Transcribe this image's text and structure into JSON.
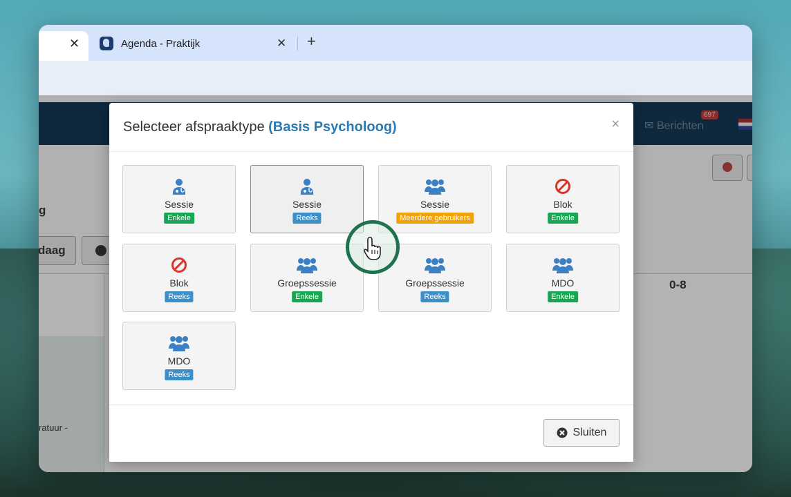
{
  "browser": {
    "tabs": [
      {
        "title": "Agenda - Praktijk"
      }
    ],
    "close_glyph": "✕",
    "new_tab_glyph": "+"
  },
  "background_page": {
    "berichten_label": "Berichten",
    "berichten_count": "697",
    "text_g": "g",
    "text_daag": "daag",
    "text_08": "0-8",
    "text_ratuur": "ratuur -"
  },
  "modal": {
    "title": "Selecteer afspraaktype",
    "title_highlight": "(Basis Psycholoog)",
    "close_glyph": "×",
    "tiles": [
      {
        "icon": "user-doctor-icon",
        "label": "Sessie",
        "badge": "Enkele",
        "badge_color": "#17a653"
      },
      {
        "icon": "user-doctor-icon",
        "label": "Sessie",
        "badge": "Reeks",
        "badge_color": "#3d8fc7"
      },
      {
        "icon": "users-icon",
        "label": "Sessie",
        "badge": "Meerdere gebruikers",
        "badge_color": "#f0a30a"
      },
      {
        "icon": "ban-icon",
        "label": "Blok",
        "badge": "Enkele",
        "badge_color": "#17a653"
      },
      {
        "icon": "ban-icon",
        "label": "Blok",
        "badge": "Reeks",
        "badge_color": "#3d8fc7"
      },
      {
        "icon": "users-icon",
        "label": "Groepssessie",
        "badge": "Enkele",
        "badge_color": "#17a653"
      },
      {
        "icon": "users-icon",
        "label": "Groepssessie",
        "badge": "Reeks",
        "badge_color": "#3d8fc7"
      },
      {
        "icon": "users-icon",
        "label": "MDO",
        "badge": "Enkele",
        "badge_color": "#17a653"
      },
      {
        "icon": "users-icon",
        "label": "MDO",
        "badge": "Reeks",
        "badge_color": "#3d8fc7"
      }
    ],
    "close_button_label": "Sluiten"
  },
  "colors": {
    "accent_blue": "#2a7ab3",
    "icon_blue": "#3b7fc4",
    "icon_red": "#d9342b",
    "navbar": "#13344f"
  }
}
